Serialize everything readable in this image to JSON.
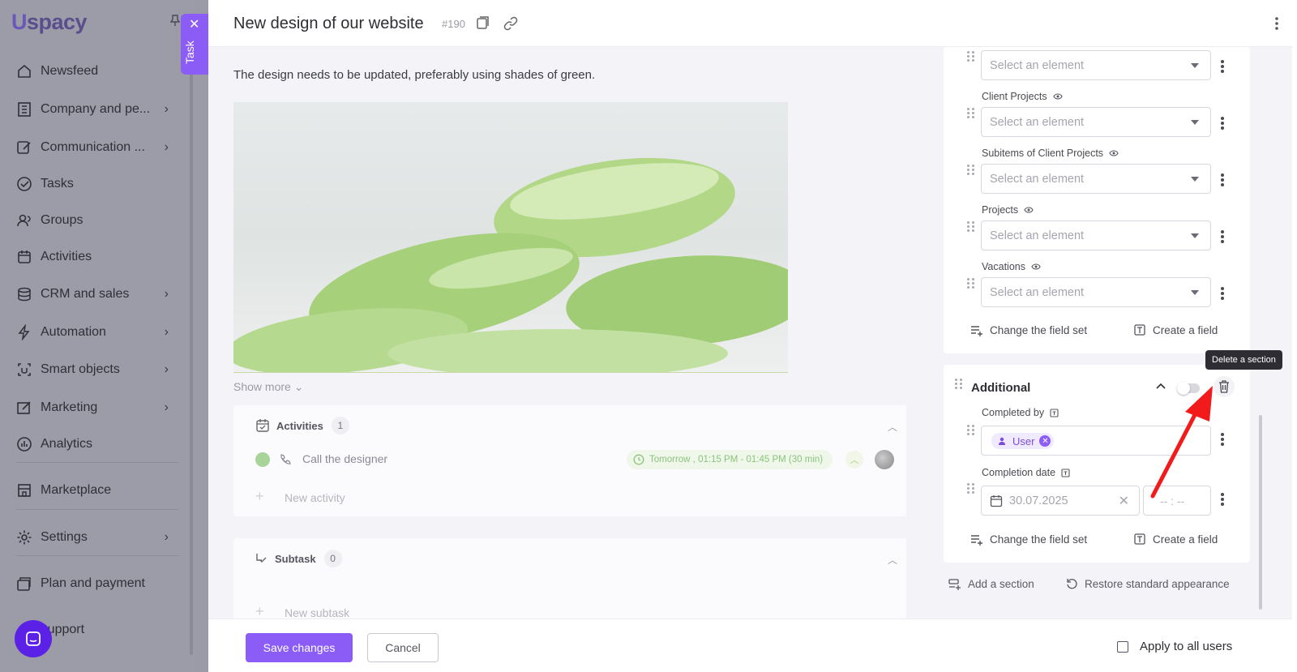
{
  "sidebar": {
    "logo": "spacy",
    "items": [
      {
        "label": "Newsfeed",
        "icon": "home-icon",
        "has_children": false
      },
      {
        "label": "Company and pe...",
        "icon": "company-icon",
        "has_children": true
      },
      {
        "label": "Communication ...",
        "icon": "communication-icon",
        "has_children": true
      },
      {
        "label": "Tasks",
        "icon": "tasks-icon",
        "has_children": false
      },
      {
        "label": "Groups",
        "icon": "groups-icon",
        "has_children": false
      },
      {
        "label": "Activities",
        "icon": "calendar-icon",
        "has_children": false
      },
      {
        "label": "CRM and sales",
        "icon": "crm-icon",
        "has_children": true
      },
      {
        "label": "Automation",
        "icon": "lightning-icon",
        "has_children": true
      },
      {
        "label": "Smart objects",
        "icon": "smart-objects-icon",
        "has_children": true
      },
      {
        "label": "Marketing",
        "icon": "marketing-icon",
        "has_children": true
      },
      {
        "label": "Analytics",
        "icon": "analytics-icon",
        "has_children": false
      },
      {
        "label": "Marketplace",
        "icon": "marketplace-icon",
        "has_children": false
      },
      {
        "label": "Settings",
        "icon": "gear-icon",
        "has_children": true
      },
      {
        "label": "Plan and payment",
        "icon": "payment-icon",
        "has_children": false
      },
      {
        "label": "Support",
        "icon": "support-icon",
        "has_children": false
      }
    ]
  },
  "task_tab": {
    "label": "Task"
  },
  "header": {
    "title": "New design of our website",
    "number": "#190"
  },
  "description": "The design needs to be updated, preferably using shades of green.",
  "show_more": "Show more",
  "activities": {
    "title": "Activities",
    "count": "1",
    "items": [
      {
        "title": "Call the designer",
        "time": "Tomorrow , 01:15 PM - 01:45 PM (30 min)"
      }
    ],
    "new_placeholder": "New activity"
  },
  "subtask": {
    "title": "Subtask",
    "count": "0",
    "new_placeholder": "New subtask"
  },
  "fields_section": {
    "fields": [
      {
        "label": "",
        "placeholder": "Select an element"
      },
      {
        "label": "Client Projects",
        "placeholder": "Select an element"
      },
      {
        "label": "Subitems of Client Projects",
        "placeholder": "Select an element"
      },
      {
        "label": "Projects",
        "placeholder": "Select an element"
      },
      {
        "label": "Vacations",
        "placeholder": "Select an element"
      }
    ],
    "change_field_set": "Change the field set",
    "create_field": "Create a field"
  },
  "additional_section": {
    "title": "Additional",
    "tooltip": "Delete a section",
    "completed_by_label": "Completed by",
    "completed_by_value": "User",
    "completion_date_label": "Completion date",
    "completion_date_value": "30.07.2025",
    "completion_time_placeholder": "-- : --",
    "change_field_set": "Change the field set",
    "create_field": "Create a field"
  },
  "add_section": "Add a section",
  "restore_appearance": "Restore standard appearance",
  "footer": {
    "save": "Save changes",
    "cancel": "Cancel",
    "apply_all": "Apply to all users"
  },
  "colors": {
    "accent": "#8b5cf6",
    "arrow": "#ff0000",
    "green_badge": "#8cc47c"
  }
}
